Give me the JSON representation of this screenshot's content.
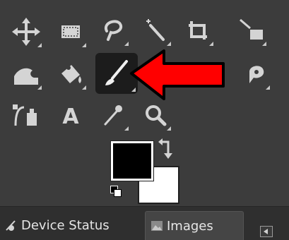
{
  "toolbox": {
    "tools": [
      {
        "icon": "move-icon"
      },
      {
        "icon": "rect-select-icon"
      },
      {
        "icon": "free-select-icon"
      },
      {
        "icon": "fuzzy-select-icon"
      },
      {
        "icon": "crop-icon"
      },
      {
        "icon": "unified-transform-icon"
      },
      {
        "icon": "warp-transform-icon"
      },
      {
        "icon": "bucket-fill-icon"
      },
      {
        "icon": "paintbrush-icon",
        "active": true
      },
      {
        "icon": "smudge-icon"
      },
      {
        "icon": "paths-icon"
      },
      {
        "icon": "text-icon",
        "label": "A"
      },
      {
        "icon": "color-picker-icon"
      },
      {
        "icon": "zoom-icon"
      }
    ],
    "colors": {
      "foreground": "#000000",
      "background": "#ffffff"
    }
  },
  "annotation": {
    "color": "#ff0000"
  },
  "dock_tabs": [
    {
      "label": "Device Status",
      "icon": "device-status-icon"
    },
    {
      "label": "Images",
      "icon": "images-icon",
      "active": true
    }
  ],
  "theme": {
    "bg": "#3c3c3c",
    "icon": "#d4d4d4",
    "active_tool_bg": "#1c1c1c"
  }
}
